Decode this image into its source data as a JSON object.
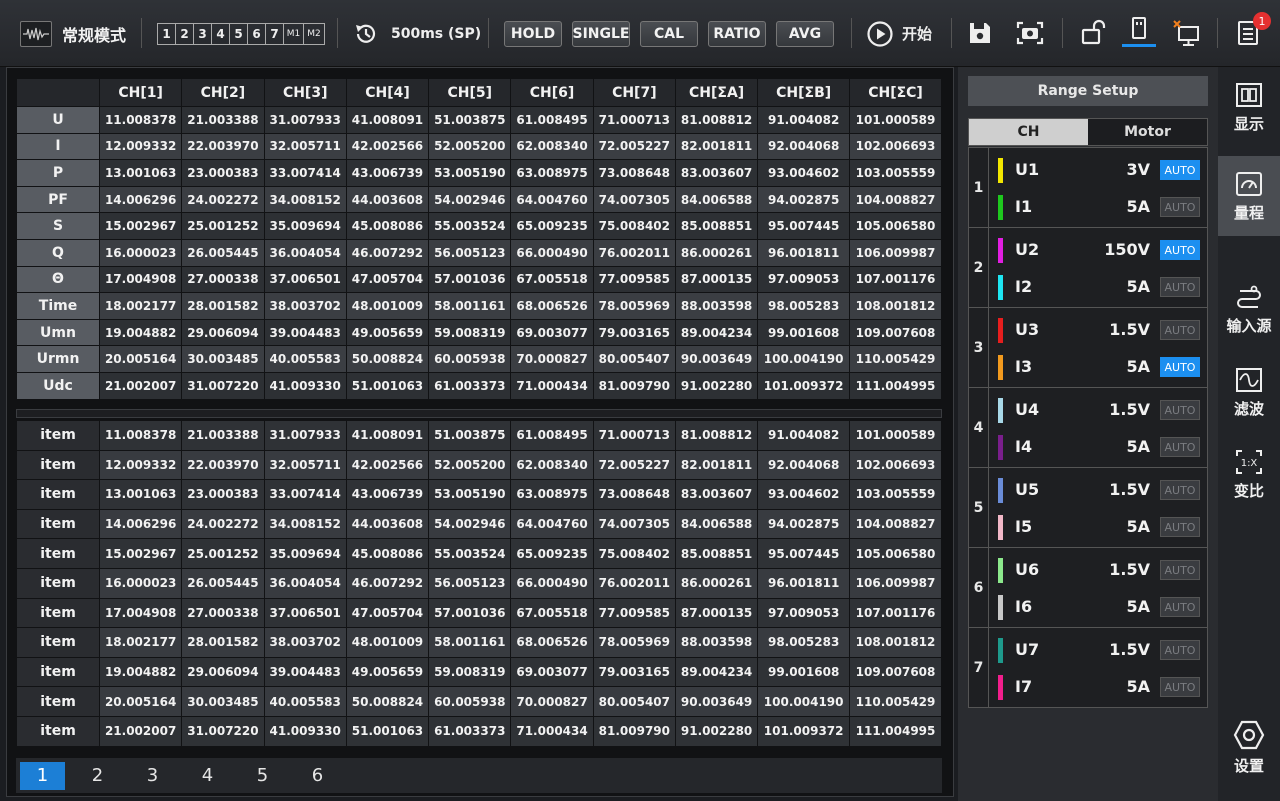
{
  "topbar": {
    "mode_label": "常规模式",
    "channels": [
      "1",
      "2",
      "3",
      "4",
      "5",
      "6",
      "7",
      "M1",
      "M2"
    ],
    "rate_label": "500ms (SP)",
    "buttons": [
      "HOLD",
      "SINGLE",
      "CAL",
      "RATIO",
      "AVG"
    ],
    "start_label": "开始",
    "notification_count": "1"
  },
  "table1": {
    "headers": [
      "",
      "CH[1]",
      "CH[2]",
      "CH[3]",
      "CH[4]",
      "CH[5]",
      "CH[6]",
      "CH[7]",
      "CH[ΣA]",
      "CH[ΣB]",
      "CH[ΣC]"
    ],
    "rows": [
      {
        "label": "U",
        "values": [
          "11.008378",
          "21.003388",
          "31.007933",
          "41.008091",
          "51.003875",
          "61.008495",
          "71.000713",
          "81.008812",
          "91.004082",
          "101.000589"
        ]
      },
      {
        "label": "I",
        "values": [
          "12.009332",
          "22.003970",
          "32.005711",
          "42.002566",
          "52.005200",
          "62.008340",
          "72.005227",
          "82.001811",
          "92.004068",
          "102.006693"
        ]
      },
      {
        "label": "P",
        "values": [
          "13.001063",
          "23.000383",
          "33.007414",
          "43.006739",
          "53.005190",
          "63.008975",
          "73.008648",
          "83.003607",
          "93.004602",
          "103.005559"
        ]
      },
      {
        "label": "PF",
        "values": [
          "14.006296",
          "24.002272",
          "34.008152",
          "44.003608",
          "54.002946",
          "64.004760",
          "74.007305",
          "84.006588",
          "94.002875",
          "104.008827"
        ]
      },
      {
        "label": "S",
        "values": [
          "15.002967",
          "25.001252",
          "35.009694",
          "45.008086",
          "55.003524",
          "65.009235",
          "75.008402",
          "85.008851",
          "95.007445",
          "105.006580"
        ]
      },
      {
        "label": "Q",
        "values": [
          "16.000023",
          "26.005445",
          "36.004054",
          "46.007292",
          "56.005123",
          "66.000490",
          "76.002011",
          "86.000261",
          "96.001811",
          "106.009987"
        ]
      },
      {
        "label": "Θ",
        "values": [
          "17.004908",
          "27.000338",
          "37.006501",
          "47.005704",
          "57.001036",
          "67.005518",
          "77.009585",
          "87.000135",
          "97.009053",
          "107.001176"
        ]
      },
      {
        "label": "Time",
        "values": [
          "18.002177",
          "28.001582",
          "38.003702",
          "48.001009",
          "58.001161",
          "68.006526",
          "78.005969",
          "88.003598",
          "98.005283",
          "108.001812"
        ]
      },
      {
        "label": "Umn",
        "values": [
          "19.004882",
          "29.006094",
          "39.004483",
          "49.005659",
          "59.008319",
          "69.003077",
          "79.003165",
          "89.004234",
          "99.001608",
          "109.007608"
        ]
      },
      {
        "label": "Urmn",
        "values": [
          "20.005164",
          "30.003485",
          "40.005583",
          "50.008824",
          "60.005938",
          "70.000827",
          "80.005407",
          "90.003649",
          "100.004190",
          "110.005429"
        ]
      },
      {
        "label": "Udc",
        "values": [
          "21.002007",
          "31.007220",
          "41.009330",
          "51.001063",
          "61.003373",
          "71.000434",
          "81.009790",
          "91.002280",
          "101.009372",
          "111.004995"
        ]
      }
    ]
  },
  "table2": {
    "rows": [
      {
        "label": "item",
        "values": [
          "11.008378",
          "21.003388",
          "31.007933",
          "41.008091",
          "51.003875",
          "61.008495",
          "71.000713",
          "81.008812",
          "91.004082",
          "101.000589"
        ]
      },
      {
        "label": "item",
        "values": [
          "12.009332",
          "22.003970",
          "32.005711",
          "42.002566",
          "52.005200",
          "62.008340",
          "72.005227",
          "82.001811",
          "92.004068",
          "102.006693"
        ]
      },
      {
        "label": "item",
        "values": [
          "13.001063",
          "23.000383",
          "33.007414",
          "43.006739",
          "53.005190",
          "63.008975",
          "73.008648",
          "83.003607",
          "93.004602",
          "103.005559"
        ]
      },
      {
        "label": "item",
        "values": [
          "14.006296",
          "24.002272",
          "34.008152",
          "44.003608",
          "54.002946",
          "64.004760",
          "74.007305",
          "84.006588",
          "94.002875",
          "104.008827"
        ]
      },
      {
        "label": "item",
        "values": [
          "15.002967",
          "25.001252",
          "35.009694",
          "45.008086",
          "55.003524",
          "65.009235",
          "75.008402",
          "85.008851",
          "95.007445",
          "105.006580"
        ]
      },
      {
        "label": "item",
        "values": [
          "16.000023",
          "26.005445",
          "36.004054",
          "46.007292",
          "56.005123",
          "66.000490",
          "76.002011",
          "86.000261",
          "96.001811",
          "106.009987"
        ]
      },
      {
        "label": "item",
        "values": [
          "17.004908",
          "27.000338",
          "37.006501",
          "47.005704",
          "57.001036",
          "67.005518",
          "77.009585",
          "87.000135",
          "97.009053",
          "107.001176"
        ]
      },
      {
        "label": "item",
        "values": [
          "18.002177",
          "28.001582",
          "38.003702",
          "48.001009",
          "58.001161",
          "68.006526",
          "78.005969",
          "88.003598",
          "98.005283",
          "108.001812"
        ]
      },
      {
        "label": "item",
        "values": [
          "19.004882",
          "29.006094",
          "39.004483",
          "49.005659",
          "59.008319",
          "69.003077",
          "79.003165",
          "89.004234",
          "99.001608",
          "109.007608"
        ]
      },
      {
        "label": "item",
        "values": [
          "20.005164",
          "30.003485",
          "40.005583",
          "50.008824",
          "60.005938",
          "70.000827",
          "80.005407",
          "90.003649",
          "100.004190",
          "110.005429"
        ]
      },
      {
        "label": "item",
        "values": [
          "21.002007",
          "31.007220",
          "41.009330",
          "51.001063",
          "61.003373",
          "71.000434",
          "81.009790",
          "91.002280",
          "101.009372",
          "111.004995"
        ]
      }
    ]
  },
  "pager": {
    "pages": [
      "1",
      "2",
      "3",
      "4",
      "5",
      "6"
    ],
    "active": 0
  },
  "range": {
    "title": "Range Setup",
    "tabs": [
      "CH",
      "Motor"
    ],
    "auto_label": "AUTO",
    "groups": [
      {
        "num": "1",
        "u": {
          "name": "U1",
          "range": "3V",
          "color": "#f2e600",
          "auto": true
        },
        "i": {
          "name": "I1",
          "range": "5A",
          "color": "#1ec81e",
          "auto": false
        }
      },
      {
        "num": "2",
        "u": {
          "name": "U2",
          "range": "150V",
          "color": "#e21ee2",
          "auto": true
        },
        "i": {
          "name": "I2",
          "range": "5A",
          "color": "#1ee6f2",
          "auto": false
        }
      },
      {
        "num": "3",
        "u": {
          "name": "U3",
          "range": "1.5V",
          "color": "#e61e1e",
          "auto": false
        },
        "i": {
          "name": "I3",
          "range": "5A",
          "color": "#f29a1e",
          "auto": true
        }
      },
      {
        "num": "4",
        "u": {
          "name": "U4",
          "range": "1.5V",
          "color": "#a8d8e8",
          "auto": false
        },
        "i": {
          "name": "I4",
          "range": "5A",
          "color": "#7a1e8c",
          "auto": false
        }
      },
      {
        "num": "5",
        "u": {
          "name": "U5",
          "range": "1.5V",
          "color": "#6a8cd8",
          "auto": false
        },
        "i": {
          "name": "I5",
          "range": "5A",
          "color": "#f2b8c8",
          "auto": false
        }
      },
      {
        "num": "6",
        "u": {
          "name": "U6",
          "range": "1.5V",
          "color": "#8ce88c",
          "auto": false
        },
        "i": {
          "name": "I6",
          "range": "5A",
          "color": "#c8c8c8",
          "auto": false
        }
      },
      {
        "num": "7",
        "u": {
          "name": "U7",
          "range": "1.5V",
          "color": "#1e9a8c",
          "auto": false
        },
        "i": {
          "name": "I7",
          "range": "5A",
          "color": "#f21e8c",
          "auto": false
        }
      }
    ]
  },
  "nav": {
    "items": [
      {
        "label": "显示",
        "icon": "display-icon"
      },
      {
        "label": "量程",
        "icon": "range-gauge-icon"
      },
      {
        "label": "输入源",
        "icon": "input-source-icon"
      },
      {
        "label": "滤波",
        "icon": "filter-wave-icon"
      },
      {
        "label": "变比",
        "icon": "ratio-icon"
      }
    ],
    "settings_label": "设置",
    "active": 1
  }
}
